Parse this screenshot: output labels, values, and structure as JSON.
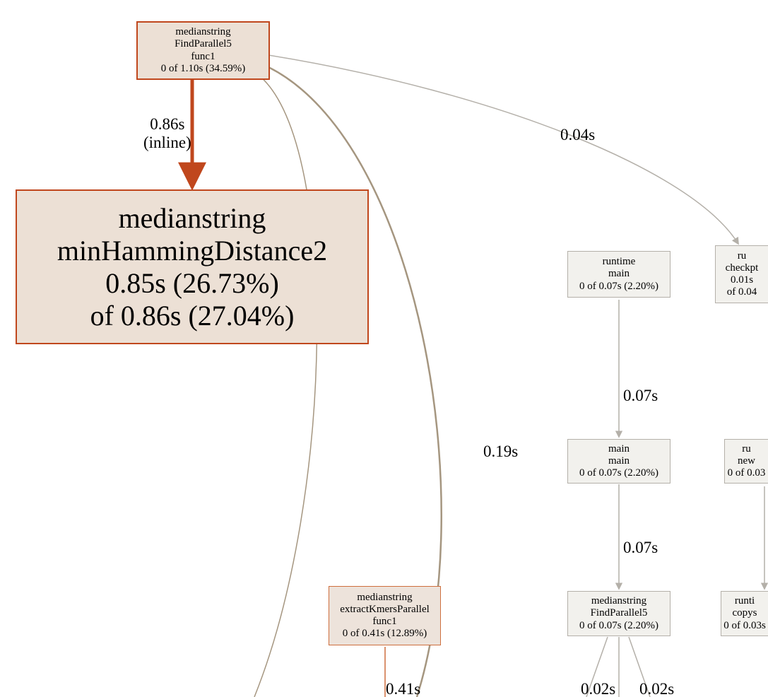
{
  "nodes": {
    "findparallel5_func1": {
      "l1": "medianstring",
      "l2": "FindParallel5",
      "l3": "func1",
      "l4": "0 of 1.10s (34.59%)"
    },
    "minhamming": {
      "l1": "medianstring",
      "l2": "minHammingDistance2",
      "l3": "0.85s (26.73%)",
      "l4": "of 0.86s (27.04%)"
    },
    "runtime_main": {
      "l1": "runtime",
      "l2": "main",
      "l3": "0 of 0.07s (2.20%)"
    },
    "checkptr": {
      "l1": "ru",
      "l2": "checkpt",
      "l3": "0.01s",
      "l4": "of 0.04"
    },
    "main_main": {
      "l1": "main",
      "l2": "main",
      "l3": "0 of 0.07s (2.20%)"
    },
    "runtime_new": {
      "l1": "ru",
      "l2": "new",
      "l3": "0 of 0.03"
    },
    "extractkmers": {
      "l1": "medianstring",
      "l2": "extractKmersParallel",
      "l3": "func1",
      "l4": "0 of 0.41s (12.89%)"
    },
    "findparallel5": {
      "l1": "medianstring",
      "l2": "FindParallel5",
      "l3": "0 of 0.07s (2.20%)"
    },
    "copys": {
      "l1": "runti",
      "l2": "copys",
      "l3": "0 of 0.03s"
    }
  },
  "edge_labels": {
    "e_086_inline": "0.86s\n(inline)",
    "e_004": "0.04s",
    "e_019": "0.19s",
    "e_007a": "0.07s",
    "e_007b": "0.07s",
    "e_041": "0.41s",
    "e_002a": "0.02s",
    "e_002b": "0.02s"
  }
}
